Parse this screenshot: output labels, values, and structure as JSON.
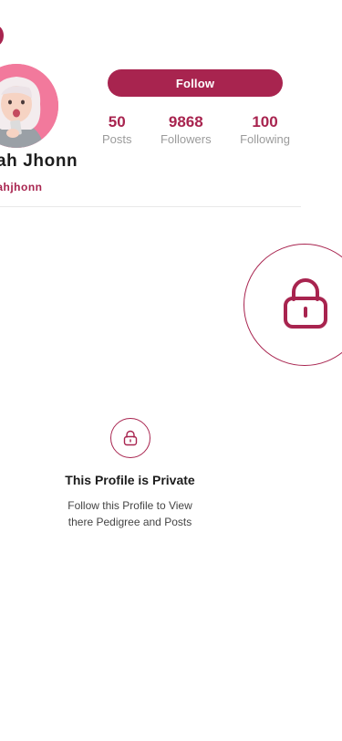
{
  "profile": {
    "name": "rah Jhonn",
    "username": "arahjhonn",
    "follow_label": "Follow",
    "stats": [
      {
        "value": "50",
        "label": "Posts"
      },
      {
        "value": "9868",
        "label": "Followers"
      },
      {
        "value": "100",
        "label": "Following"
      }
    ]
  },
  "private_notice": {
    "title": "This Profile is Private",
    "line1": "Follow this Profile to View",
    "line2": "there Pedigree and Posts"
  },
  "colors": {
    "accent": "#a8244f",
    "avatar_bg": "#f2799c",
    "muted": "#9b9b9b",
    "divider": "#e8e8e8"
  },
  "icons": {
    "back": "back-icon",
    "lock": "lock-icon"
  }
}
